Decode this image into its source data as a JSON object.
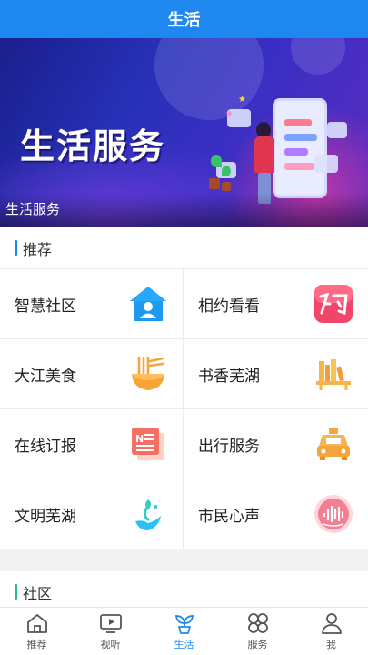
{
  "header": {
    "title": "生活"
  },
  "banner": {
    "headline": "生活服务",
    "caption": "生活服务"
  },
  "sections": {
    "recommend": {
      "title": "推荐",
      "accent": "#1e88f0",
      "items": [
        {
          "label": "智慧社区",
          "icon": "house-person-icon"
        },
        {
          "label": "相约看看",
          "icon": "yue-badge-icon"
        },
        {
          "label": "大江美食",
          "icon": "noodle-bowl-icon"
        },
        {
          "label": "书香芜湖",
          "icon": "bookshelf-icon"
        },
        {
          "label": "在线订报",
          "icon": "newspaper-icon"
        },
        {
          "label": "出行服务",
          "icon": "taxi-icon"
        },
        {
          "label": "文明芜湖",
          "icon": "hand-leaf-icon"
        },
        {
          "label": "市民心声",
          "icon": "voice-wave-icon"
        }
      ]
    },
    "community": {
      "title": "社区",
      "accent": "#2fb87a"
    }
  },
  "tabbar": {
    "items": [
      {
        "label": "推荐",
        "icon": "home-icon",
        "active": false
      },
      {
        "label": "视听",
        "icon": "tv-play-icon",
        "active": false
      },
      {
        "label": "生活",
        "icon": "sprout-icon",
        "active": true
      },
      {
        "label": "服务",
        "icon": "grid-flower-icon",
        "active": false
      },
      {
        "label": "我",
        "icon": "user-icon",
        "active": false
      }
    ]
  },
  "colors": {
    "brand": "#1e88f0",
    "voice_badge": "#e8456a"
  }
}
